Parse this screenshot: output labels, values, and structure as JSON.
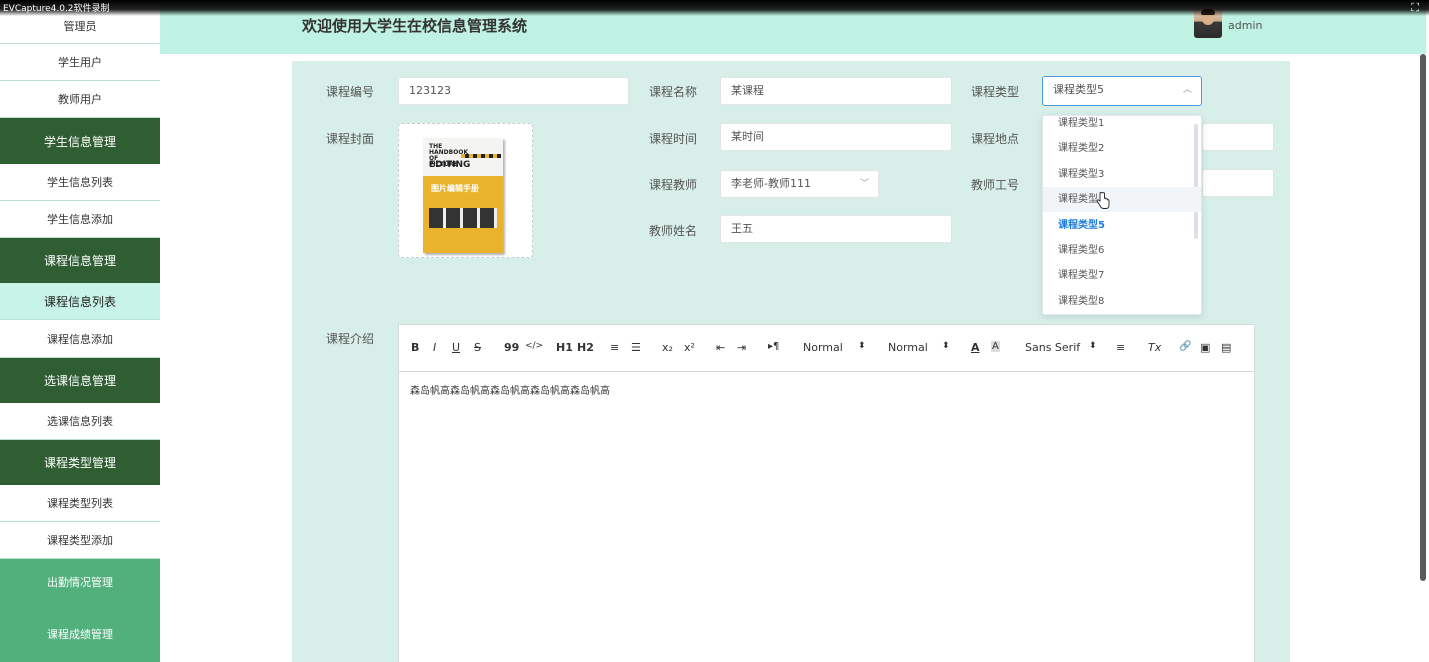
{
  "recorder": {
    "label": "EVCapture4.0.2软件录制"
  },
  "header": {
    "title": "欢迎使用大学生在校信息管理系统",
    "user": "admin"
  },
  "sidebar": {
    "items": [
      {
        "label": "管理员",
        "kind": "item"
      },
      {
        "label": "学生用户",
        "kind": "item"
      },
      {
        "label": "教师用户",
        "kind": "item"
      },
      {
        "label": "学生信息管理",
        "kind": "group"
      },
      {
        "label": "学生信息列表",
        "kind": "item"
      },
      {
        "label": "学生信息添加",
        "kind": "item"
      },
      {
        "label": "课程信息管理",
        "kind": "group"
      },
      {
        "label": "课程信息列表",
        "kind": "active"
      },
      {
        "label": "课程信息添加",
        "kind": "item"
      },
      {
        "label": "选课信息管理",
        "kind": "group"
      },
      {
        "label": "选课信息列表",
        "kind": "item"
      },
      {
        "label": "课程类型管理",
        "kind": "group"
      },
      {
        "label": "课程类型列表",
        "kind": "item"
      },
      {
        "label": "课程类型添加",
        "kind": "item"
      },
      {
        "label": "出勤情况管理",
        "kind": "group-light"
      },
      {
        "label": "课程成绩管理",
        "kind": "group-light"
      }
    ]
  },
  "form": {
    "course_no": {
      "label": "课程编号",
      "value": "123123"
    },
    "course_name": {
      "label": "课程名称",
      "value": "某课程"
    },
    "course_type": {
      "label": "课程类型",
      "value": "课程类型5"
    },
    "cover": {
      "label": "课程封面",
      "book_title_en": "THE HANDBOOK OF PICTURE",
      "book_title_en2": "EDITING",
      "book_title_cn": "图片编辑手册"
    },
    "course_time": {
      "label": "课程时间",
      "value": "某时间"
    },
    "course_place": {
      "label": "课程地点",
      "value": ""
    },
    "teacher": {
      "label": "课程教师",
      "value": "李老师-教师111"
    },
    "teacher_no": {
      "label": "教师工号",
      "value": ""
    },
    "teacher_name": {
      "label": "教师姓名",
      "value": "王五"
    },
    "intro": {
      "label": "课程介绍",
      "value": "森岛帆高森岛帆高森岛帆高森岛帆高森岛帆高"
    }
  },
  "dropdown": {
    "options": [
      "课程类型1",
      "课程类型2",
      "课程类型3",
      "课程类型4",
      "课程类型5",
      "课程类型6",
      "课程类型7",
      "课程类型8"
    ],
    "selected_index": 4,
    "hover_index": 3,
    "hover_visible_text": "课程类型"
  },
  "editor_toolbar": {
    "bold": "B",
    "italic": "I",
    "underline": "U",
    "strike": "S",
    "blockquote": "99",
    "code": "</>",
    "h1": "H1",
    "h2": "H2",
    "ordered_list": "≡",
    "bullet_list": "☰",
    "sub": "x₂",
    "sup": "x²",
    "outdent": "⇤",
    "indent": "⇥",
    "direction": "▸¶",
    "size_select": "Normal",
    "header_select": "Normal",
    "color": "A",
    "background": "A",
    "font_select": "Sans Serif",
    "align": "≡",
    "clean": "Tx",
    "link": "🔗",
    "image": "▣",
    "video": "▤"
  },
  "colors": {
    "sidebar_group": "#2e5e32",
    "sidebar_group_light": "#51b07c",
    "sidebar_active": "#c8f3e7",
    "header_bg": "#bff2e3",
    "panel_bg": "#d8efe9",
    "select_focus": "#4c9bde",
    "option_selected": "#1f7ee0"
  }
}
